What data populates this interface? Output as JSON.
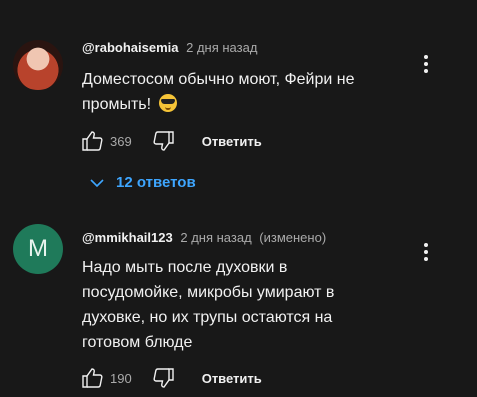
{
  "comments": [
    {
      "author": "@rabohaisemia",
      "time": "2 дня назад",
      "edited": "",
      "text": "Доместосом обычно моют, Фейри не промыть!",
      "emoji": "smiling-face-with-sunglasses",
      "likes": "369",
      "reply_label": "Ответить",
      "avatar_type": "photo",
      "replies_label": "12 ответов"
    },
    {
      "author": "@mmikhail123",
      "time": "2 дня назад",
      "edited": "(изменено)",
      "text": "Надо мыть после духовки в посудомойке, микробы умирают в духовке, но их трупы остаются на готовом блюде",
      "likes": "190",
      "reply_label": "Ответить",
      "avatar_type": "letter",
      "avatar_letter": "M",
      "avatar_color": "#1f7a5a"
    }
  ],
  "colors": {
    "background": "#181818",
    "accent": "#3ea6ff",
    "muted": "#aaaaaa"
  }
}
